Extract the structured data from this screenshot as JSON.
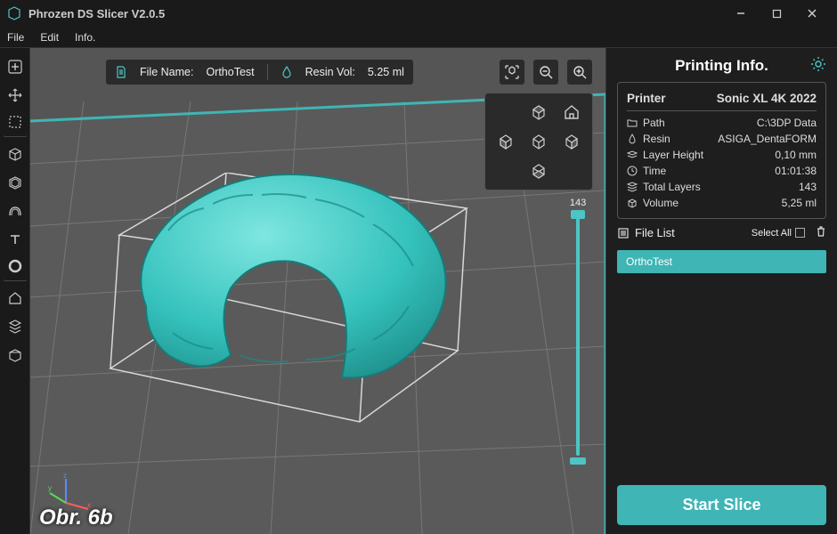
{
  "window": {
    "title": "Phrozen DS Slicer  V2.0.5"
  },
  "menu": {
    "file": "File",
    "edit": "Edit",
    "info": "Info."
  },
  "infobar": {
    "filename_label": "File Name:",
    "filename": "OrthoTest",
    "resinvol_label": "Resin Vol:",
    "resinvol": "5.25 ml"
  },
  "layer_slider": {
    "max": "143"
  },
  "right": {
    "title": "Printing Info.",
    "printer_label": "Printer",
    "printer": "Sonic XL 4K 2022",
    "path_label": "Path",
    "path": "C:\\3DP Data",
    "resin_label": "Resin",
    "resin": "ASIGA_DentaFORM",
    "layerh_label": "Layer Height",
    "layerh": "0,10 mm",
    "time_label": "Time",
    "time": "01:01:38",
    "layers_label": "Total Layers",
    "layers": "143",
    "volume_label": "Volume",
    "volume": "5,25 ml",
    "filelist_label": "File List",
    "selectall": "Select All",
    "files": [
      "OrthoTest"
    ],
    "start": "Start Slice"
  },
  "caption": "Obr. 6b",
  "icons": {
    "add": "add-icon",
    "move": "move-icon",
    "scale": "scale-icon",
    "cube": "cube-icon",
    "shell": "shell-icon",
    "arch": "arch-icon",
    "text": "text-icon",
    "ring": "ring-icon",
    "house": "house-icon",
    "stack": "stack-icon",
    "package": "package-icon"
  }
}
